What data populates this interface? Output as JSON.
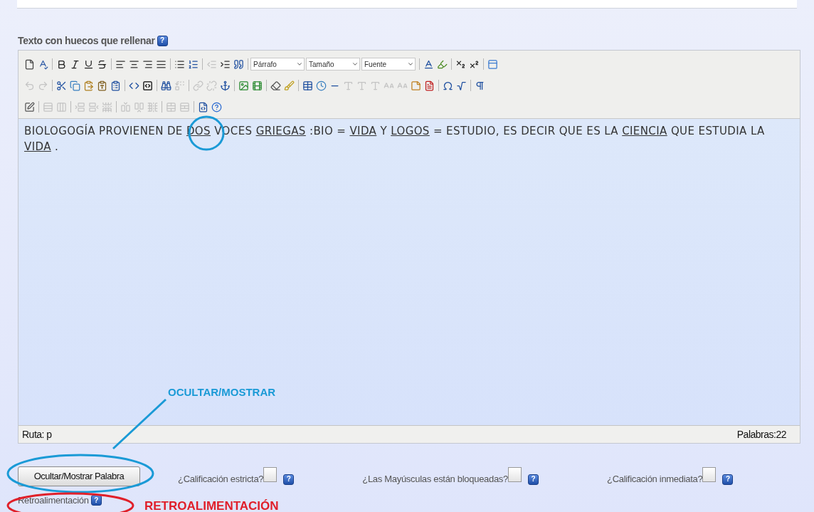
{
  "heading": {
    "label": "Texto con huecos que rellenar",
    "help": "?"
  },
  "toolbar": [
    [
      {
        "kind": "new",
        "disabled": false
      },
      {
        "kind": "spellcheck",
        "disabled": false
      },
      {
        "kind": "separator"
      },
      {
        "kind": "bold",
        "disabled": false
      },
      {
        "kind": "italic",
        "disabled": false
      },
      {
        "kind": "underline",
        "disabled": false
      },
      {
        "kind": "strike",
        "disabled": false
      },
      {
        "kind": "separator"
      },
      {
        "kind": "align-left",
        "disabled": false
      },
      {
        "kind": "align-center",
        "disabled": false
      },
      {
        "kind": "align-right",
        "disabled": false
      },
      {
        "kind": "justify",
        "disabled": false
      },
      {
        "kind": "separator"
      },
      {
        "kind": "bullets",
        "disabled": false
      },
      {
        "kind": "numbers",
        "disabled": false
      },
      {
        "kind": "separator"
      },
      {
        "kind": "outdent",
        "disabled": true
      },
      {
        "kind": "indent",
        "disabled": false
      },
      {
        "kind": "quote",
        "disabled": false
      },
      {
        "kind": "separator"
      },
      {
        "kind": "select",
        "label": "Párrafo"
      },
      {
        "kind": "select",
        "label": "Tamaño"
      },
      {
        "kind": "select",
        "label": "Fuente"
      },
      {
        "kind": "separator"
      },
      {
        "kind": "font-color",
        "disabled": false
      },
      {
        "kind": "highlight",
        "disabled": false
      },
      {
        "kind": "separator"
      },
      {
        "kind": "subscript",
        "disabled": false
      },
      {
        "kind": "superscript",
        "disabled": false
      },
      {
        "kind": "separator"
      },
      {
        "kind": "blocks",
        "disabled": false
      }
    ],
    [
      {
        "kind": "undo",
        "disabled": true
      },
      {
        "kind": "redo",
        "disabled": true
      },
      {
        "kind": "separator"
      },
      {
        "kind": "cut",
        "disabled": false
      },
      {
        "kind": "copy",
        "disabled": false
      },
      {
        "kind": "paste",
        "disabled": false
      },
      {
        "kind": "paste-text",
        "disabled": false
      },
      {
        "kind": "paste-word",
        "disabled": false
      },
      {
        "kind": "separator"
      },
      {
        "kind": "code",
        "disabled": false
      },
      {
        "kind": "source",
        "disabled": false
      },
      {
        "kind": "separator"
      },
      {
        "kind": "find",
        "disabled": false
      },
      {
        "kind": "replace",
        "disabled": true
      },
      {
        "kind": "separator"
      },
      {
        "kind": "link",
        "disabled": true
      },
      {
        "kind": "unlink",
        "disabled": true
      },
      {
        "kind": "anchor",
        "disabled": false
      },
      {
        "kind": "separator"
      },
      {
        "kind": "image",
        "disabled": false
      },
      {
        "kind": "media",
        "disabled": false
      },
      {
        "kind": "separator"
      },
      {
        "kind": "eraser",
        "disabled": false
      },
      {
        "kind": "cleanup",
        "disabled": false
      },
      {
        "kind": "separator"
      },
      {
        "kind": "table",
        "disabled": false
      },
      {
        "kind": "clock",
        "disabled": false
      },
      {
        "kind": "rule",
        "disabled": false
      },
      {
        "kind": "abbr",
        "disabled": true
      },
      {
        "kind": "acronym",
        "disabled": true
      },
      {
        "kind": "cite",
        "disabled": true
      },
      {
        "kind": "letter",
        "disabled": true
      },
      {
        "kind": "letter",
        "disabled": true
      },
      {
        "kind": "note",
        "disabled": false
      },
      {
        "kind": "pdf",
        "disabled": false
      },
      {
        "kind": "separator"
      },
      {
        "kind": "omega",
        "disabled": false
      },
      {
        "kind": "radical",
        "disabled": false
      },
      {
        "kind": "separator"
      },
      {
        "kind": "style",
        "disabled": false
      }
    ],
    [
      {
        "kind": "edit",
        "disabled": false
      },
      {
        "kind": "separator"
      },
      {
        "kind": "rows",
        "disabled": true
      },
      {
        "kind": "columns",
        "disabled": true
      },
      {
        "kind": "separator"
      },
      {
        "kind": "row-before",
        "disabled": true
      },
      {
        "kind": "row-after",
        "disabled": true
      },
      {
        "kind": "row-delete",
        "disabled": true
      },
      {
        "kind": "separator"
      },
      {
        "kind": "col-before",
        "disabled": true
      },
      {
        "kind": "col-after",
        "disabled": true
      },
      {
        "kind": "col-delete",
        "disabled": true
      },
      {
        "kind": "separator"
      },
      {
        "kind": "merge",
        "disabled": true
      },
      {
        "kind": "split",
        "disabled": true
      },
      {
        "kind": "separator"
      },
      {
        "kind": "html",
        "disabled": false
      },
      {
        "kind": "help",
        "disabled": false
      }
    ]
  ],
  "content": [
    {
      "text": "BIOLOGOGÍA PROVIENEN DE ",
      "gap": false
    },
    {
      "text": "DOS",
      "gap": true
    },
    {
      "text": " VOCES ",
      "gap": false
    },
    {
      "text": "GRIEGAS",
      "gap": true
    },
    {
      "text": " :BIO = ",
      "gap": false
    },
    {
      "text": "VIDA",
      "gap": true
    },
    {
      "text": " Y ",
      "gap": false
    },
    {
      "text": "LOGOS",
      "gap": true
    },
    {
      "text": " = ESTUDIO, ES DECIR QUE ES LA ",
      "gap": false
    },
    {
      "text": "CIENCIA",
      "gap": true
    },
    {
      "text": " QUE ESTUDIA LA ",
      "gap": false
    },
    {
      "text": "VIDA",
      "gap": true
    },
    {
      "text": " .",
      "gap": false
    }
  ],
  "status_bar": {
    "path": "Ruta: p",
    "words": "Palabras:22"
  },
  "button": "Ocultar/Mostrar Palabra",
  "options": [
    {
      "label": "¿Calificación estricta?",
      "checked": false,
      "help": "?"
    },
    {
      "label": "¿Las Mayúsculas están bloqueadas?",
      "checked": false,
      "help": "?"
    },
    {
      "label": "¿Calificación inmediata?",
      "checked": false,
      "help": "?"
    }
  ],
  "feedback": {
    "label": "Retroalimentación",
    "help": "?"
  },
  "annotations": [
    {
      "kind": "circle",
      "color": "#1a9ad6"
    },
    {
      "kind": "callout",
      "label": "OCULTAR/MOSTRAR",
      "color": "#1a9ad6"
    },
    {
      "kind": "ellipse-button",
      "color": "#1a9ad6"
    },
    {
      "kind": "ellipse-feedback",
      "label": "RETROALIMENTACIÓN",
      "color": "#e0202a"
    }
  ]
}
